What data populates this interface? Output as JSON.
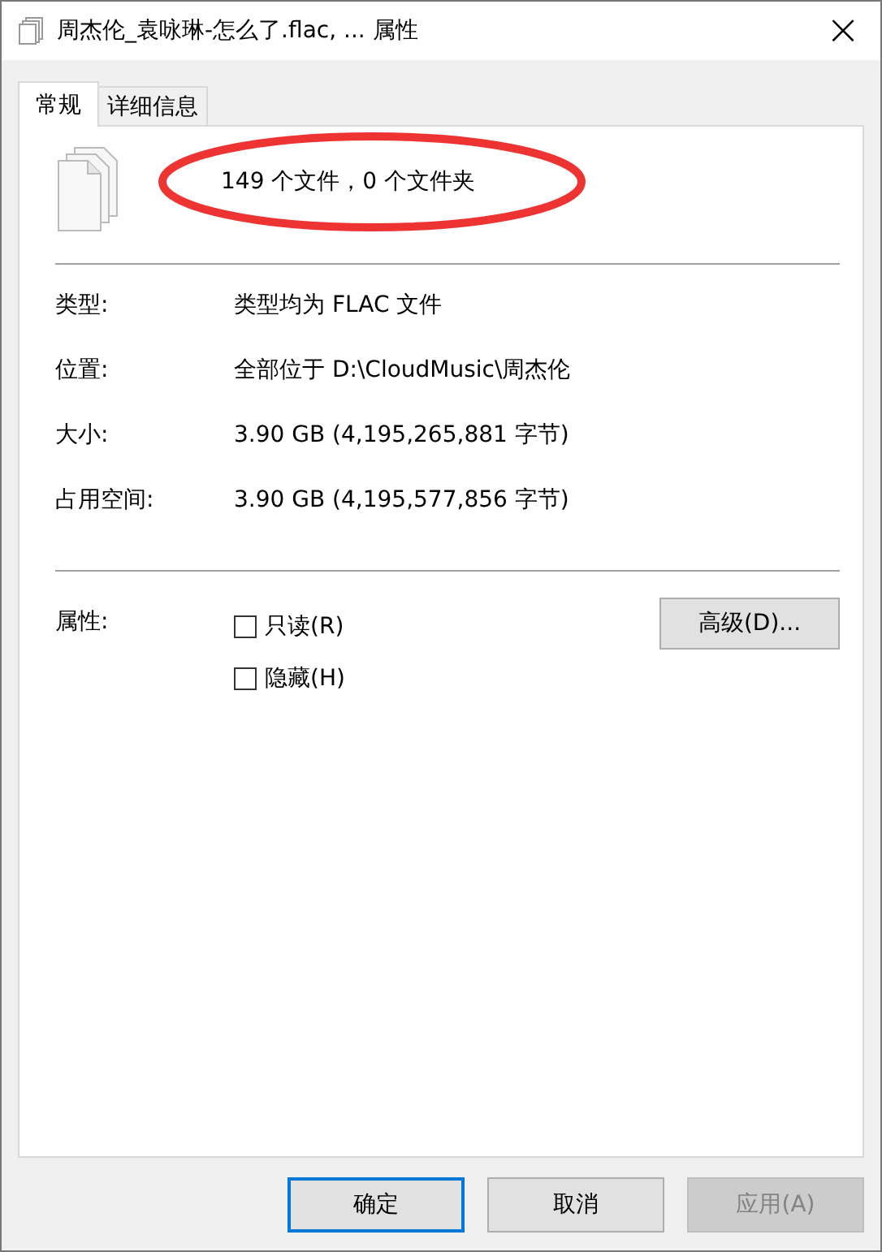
{
  "window": {
    "title": "周杰伦_袁咏琳-怎么了.flac, ... 属性",
    "close": "×"
  },
  "tabs": [
    {
      "label": "常规",
      "selected": true
    },
    {
      "label": "详细信息",
      "selected": false
    }
  ],
  "summary": "149 个文件，0 个文件夹",
  "highlight": {
    "kind": "ellipse",
    "color": "#ee3333"
  },
  "details": [
    {
      "label": "类型:",
      "value": "类型均为 FLAC 文件"
    },
    {
      "label": "位置:",
      "value": "全部位于 D:\\CloudMusic\\周杰伦"
    },
    {
      "label": "大小:",
      "value": "3.90 GB (4,195,265,881 字节)"
    },
    {
      "label": "占用空间:",
      "value": "3.90 GB (4,195,577,856 字节)"
    }
  ],
  "attributes": {
    "label": "属性:",
    "options": [
      {
        "label": "只读(R)",
        "checked": false
      },
      {
        "label": "隐藏(H)",
        "checked": false
      }
    ],
    "advanced_button": "高级(D)..."
  },
  "buttons": [
    {
      "label": "确定",
      "default": true,
      "disabled": false
    },
    {
      "label": "取消",
      "default": false,
      "disabled": false
    },
    {
      "label": "应用(A)",
      "default": false,
      "disabled": true
    }
  ]
}
